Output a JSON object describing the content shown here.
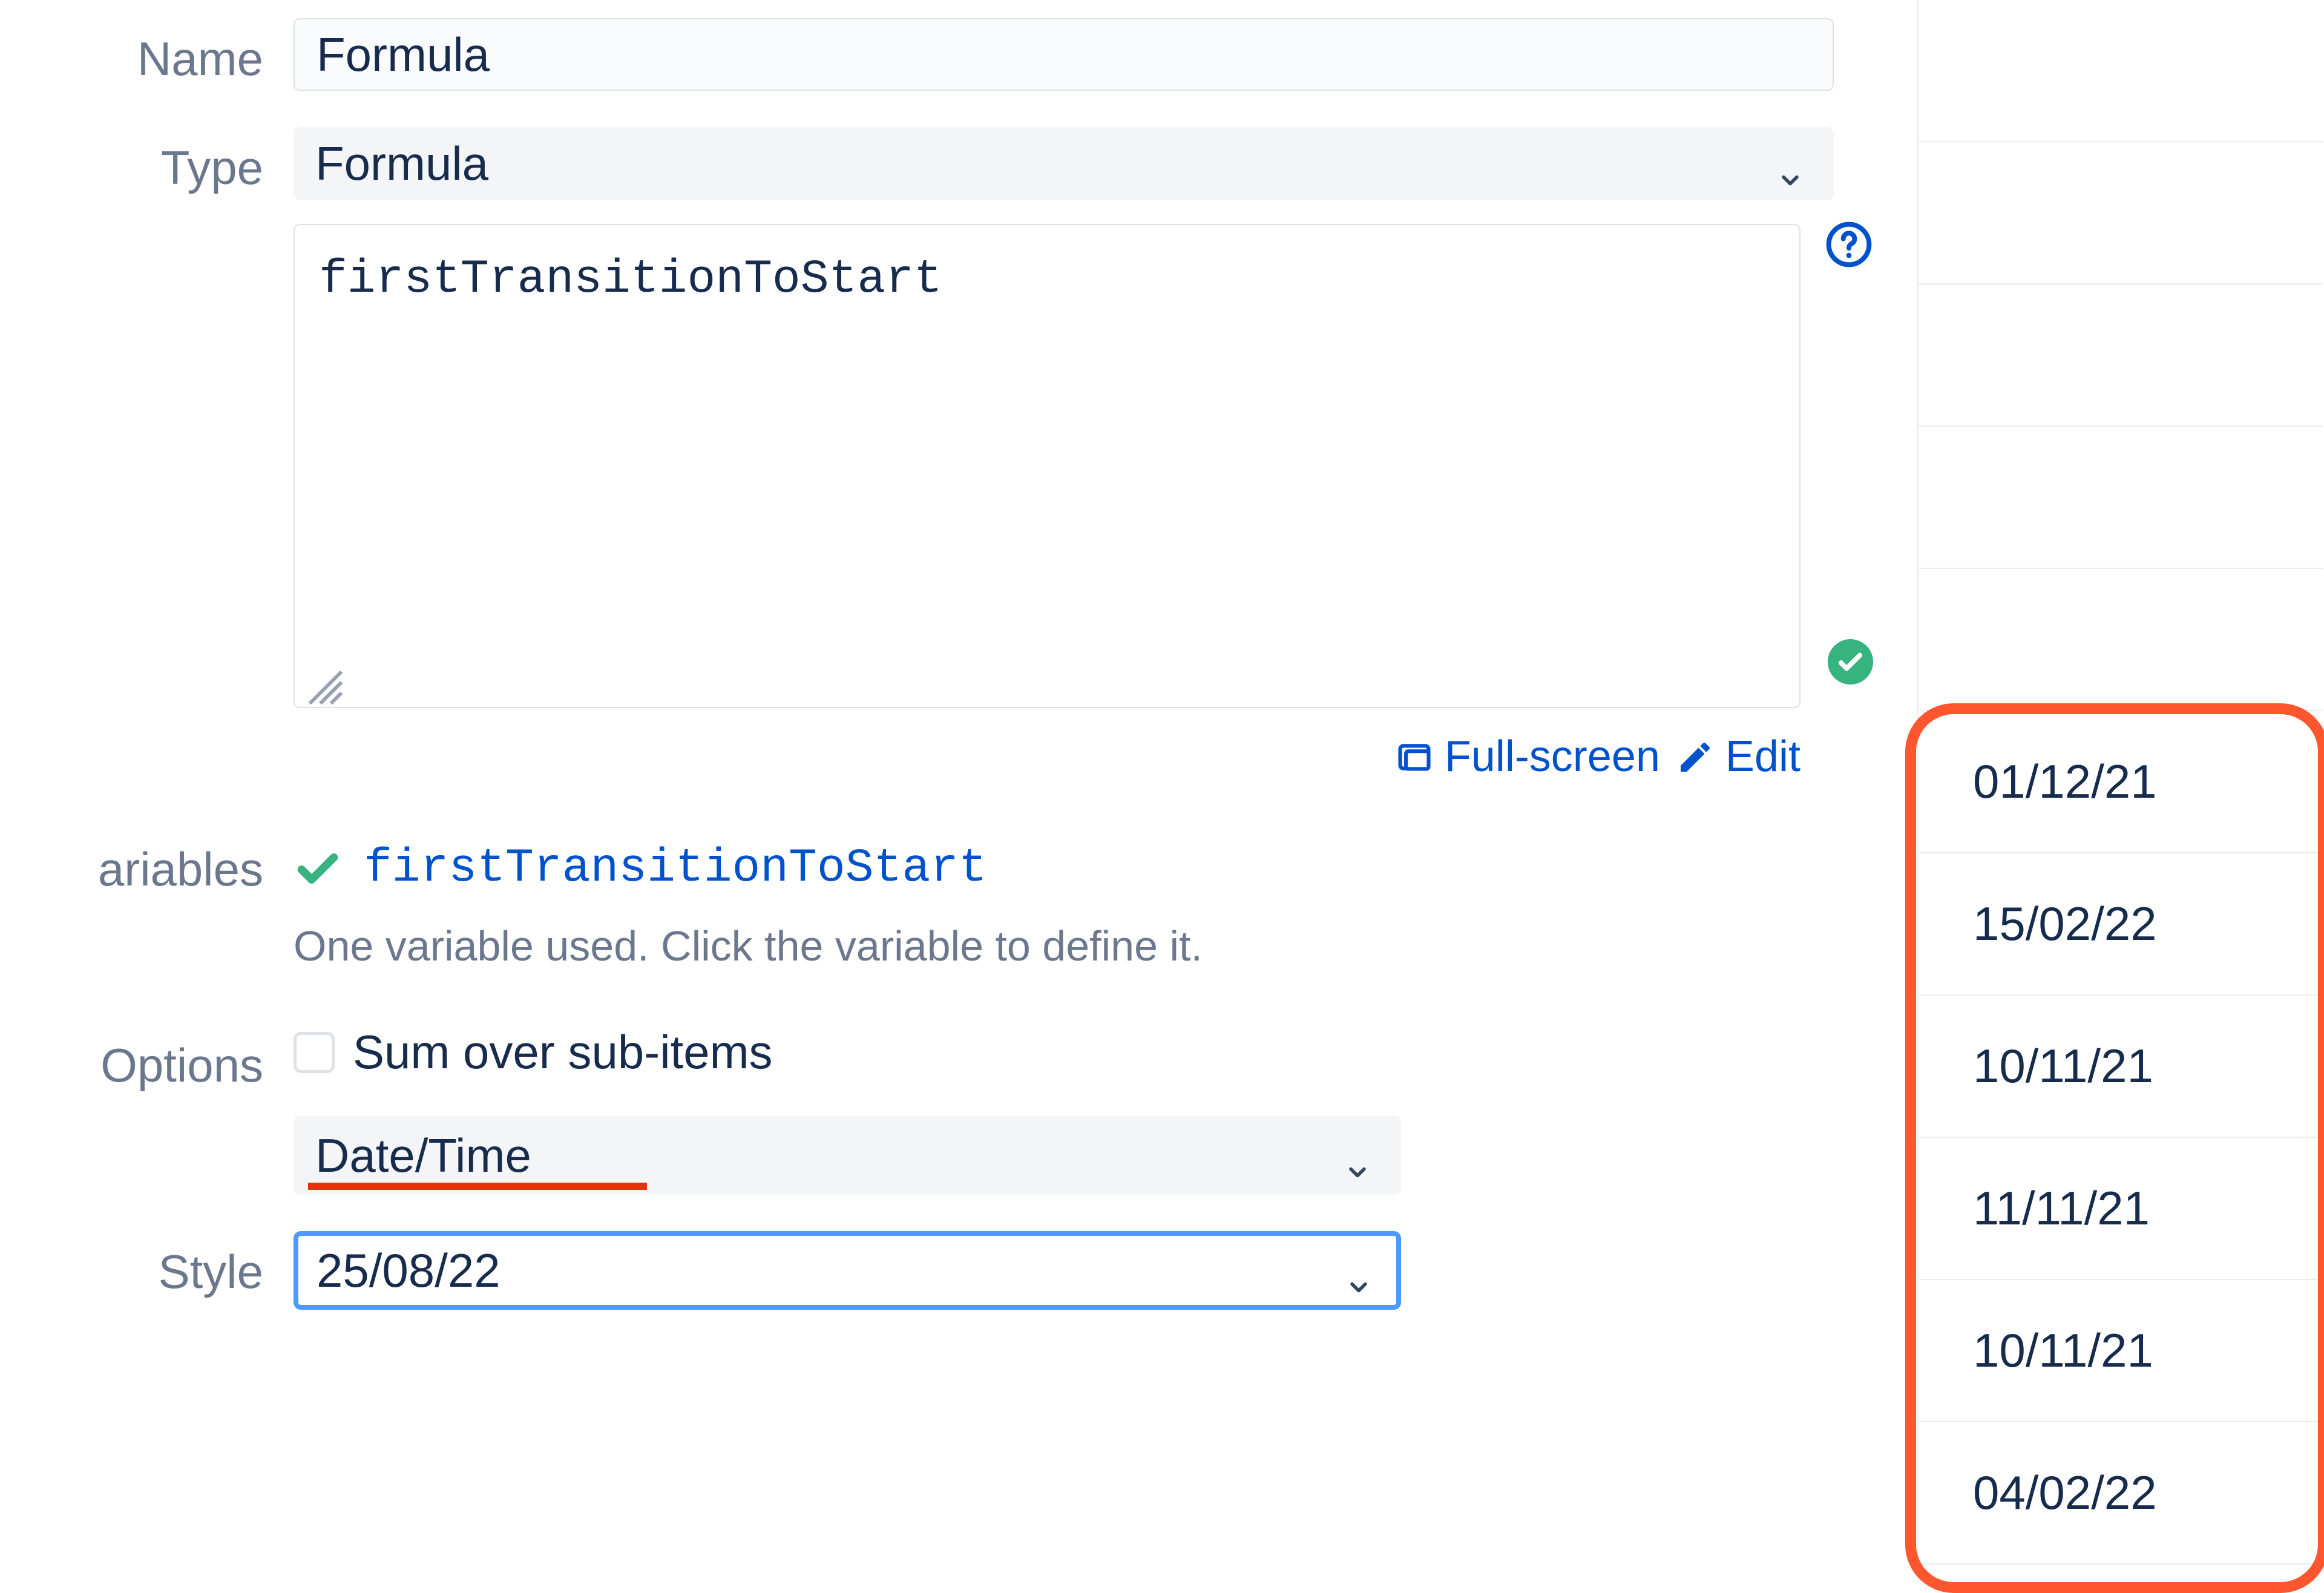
{
  "labels": {
    "name": "Name",
    "type": "Type",
    "variables": "ariables",
    "options": "Options",
    "style": "Style"
  },
  "fields": {
    "name_value": "Formula",
    "type_value": "Formula",
    "formula_value": "firstTransitionToStart",
    "format_value": "Date/Time",
    "style_value": "25/08/22"
  },
  "variables": {
    "name": "firstTransitionToStart",
    "hint": "One variable used. Click the variable to define it."
  },
  "options_checkbox": {
    "label": "Sum over sub-items"
  },
  "links": {
    "fullscreen": "Full-screen",
    "edit": "Edit"
  },
  "dates": [
    "01/12/21",
    "15/02/22",
    "10/11/21",
    "11/11/21",
    "10/11/21",
    "04/02/22"
  ]
}
